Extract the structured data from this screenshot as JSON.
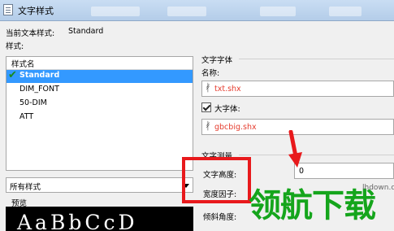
{
  "window": {
    "title": "文字样式"
  },
  "current_style": {
    "label": "当前文本样式:",
    "value": "Standard"
  },
  "styles_label": "样式:",
  "style_list": {
    "header": "样式名",
    "items": [
      "Standard",
      "DIM_FONT",
      "50-DIM",
      "ATT"
    ],
    "selected_index": 0
  },
  "filter": {
    "value": "所有样式"
  },
  "preview": {
    "label": "预览",
    "sample": "AaBbCcD"
  },
  "font_section": {
    "title": "文字字体",
    "name_label": "名称:",
    "font_name": "txt.shx",
    "bigfont_checked": true,
    "bigfont_label": "大字体:",
    "bigfont_name": "gbcbig.shx"
  },
  "measure_section": {
    "title": "文字测量",
    "height_label": "文字高度:",
    "height_value": "0",
    "width_label": "宽度因子:",
    "oblique_label": "倾斜角度:"
  },
  "watermark": {
    "logo": "领航下载",
    "url": "lhdown.com"
  },
  "colors": {
    "accent_red": "#e8191c",
    "selection": "#3399ff",
    "font_red": "#e53c2e",
    "watermark_green": "#15a51c"
  },
  "icons": {
    "title": "document-icon",
    "font": "font-compass-icon",
    "check": "checkmark-icon"
  }
}
